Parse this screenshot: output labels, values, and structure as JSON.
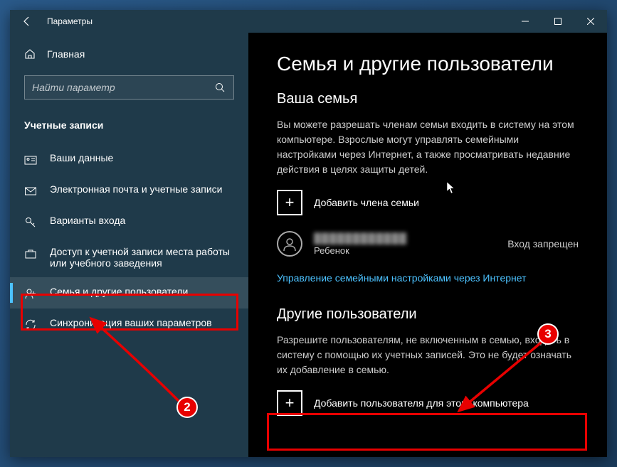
{
  "titlebar": {
    "title": "Параметры"
  },
  "sidebar": {
    "home": "Главная",
    "search_placeholder": "Найти параметр",
    "category": "Учетные записи",
    "items": [
      {
        "label": "Ваши данные"
      },
      {
        "label": "Электронная почта и учетные записи"
      },
      {
        "label": "Варианты входа"
      },
      {
        "label": "Доступ к учетной записи места работы или учебного заведения"
      },
      {
        "label": "Семья и другие пользователи"
      },
      {
        "label": "Синхронизация ваших параметров"
      }
    ]
  },
  "content": {
    "heading": "Семья и другие пользователи",
    "family_title": "Ваша семья",
    "family_desc": "Вы можете разрешать членам семьи входить в систему на этом компьютере. Взрослые могут управлять семейными настройками через Интернет, а также просматривать недавние действия в целях защиты детей.",
    "add_family": "Добавить члена семьи",
    "member": {
      "name": "████████████",
      "role": "Ребенок",
      "status": "Вход запрещен"
    },
    "manage_link": "Управление семейными настройками через Интернет",
    "others_title": "Другие пользователи",
    "others_desc": "Разрешите пользователям, не включенным в семью, входить в систему с помощью их учетных записей. Это не будет означать их добавление в семью.",
    "add_other": "Добавить пользователя для этого компьютера"
  },
  "annotations": {
    "badge2": "2",
    "badge3": "3"
  }
}
